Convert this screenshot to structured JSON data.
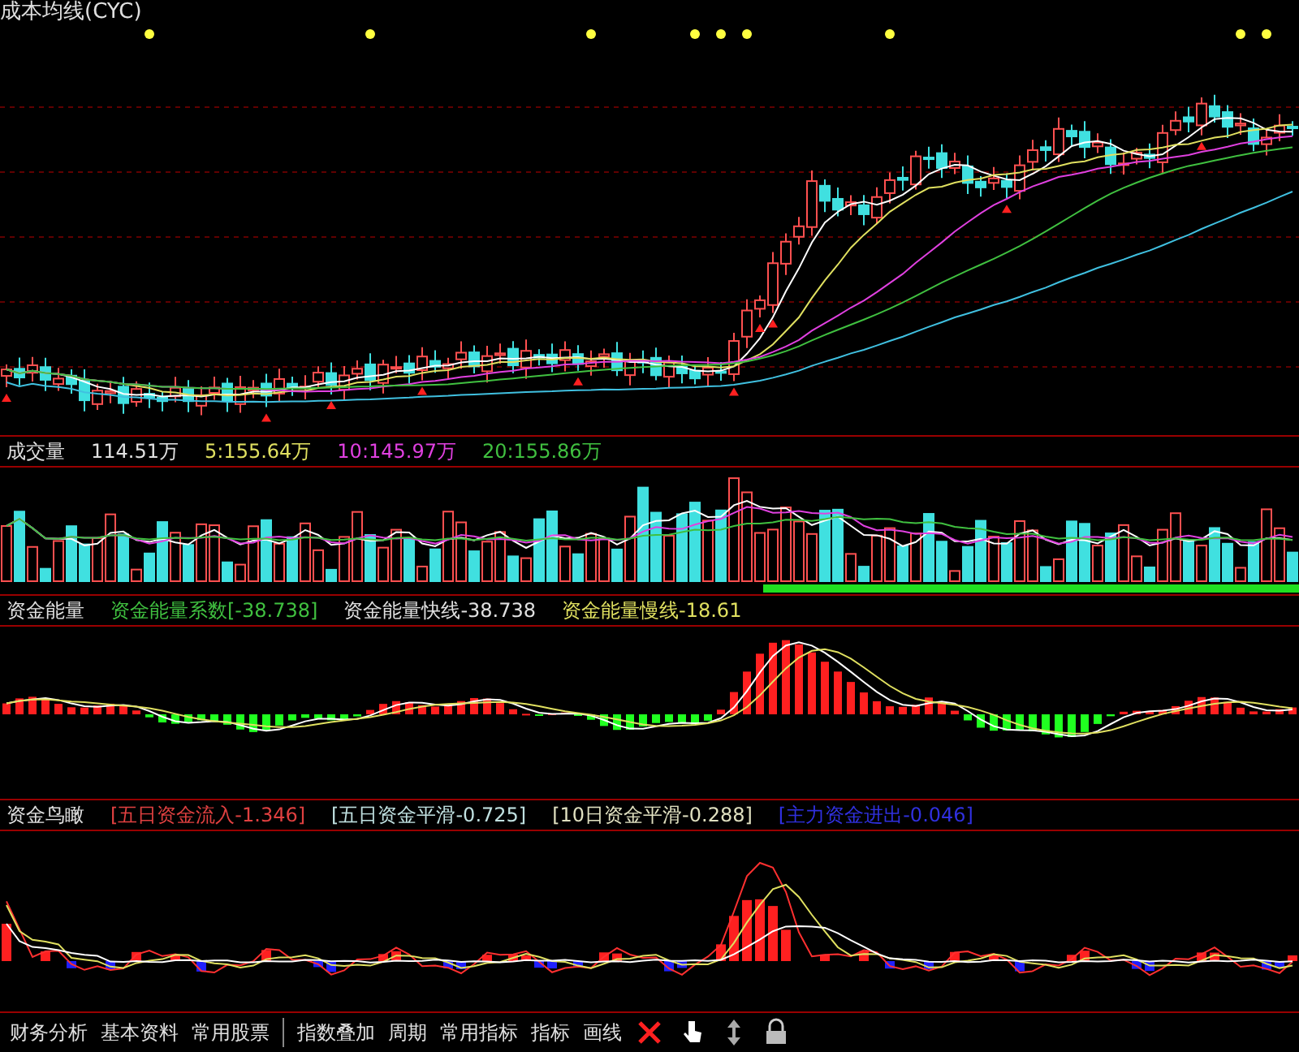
{
  "main_panel": {
    "title": "成本均线(CYC)"
  },
  "volume_panel": {
    "legend": [
      {
        "text": "成交量",
        "color": "#e0e0e0"
      },
      {
        "text": "114.51万",
        "color": "#e0e0e0"
      },
      {
        "text": "5:155.64万",
        "color": "#e0e060"
      },
      {
        "text": "10:145.97万",
        "color": "#e040e0"
      },
      {
        "text": "20:155.86万",
        "color": "#40c040"
      }
    ]
  },
  "energy_panel": {
    "legend": [
      {
        "text": "资金能量",
        "color": "#e0e0e0"
      },
      {
        "text": "资金能量系数[-38.738]",
        "color": "#40c040"
      },
      {
        "text": "资金能量快线-38.738",
        "color": "#e0e0e0"
      },
      {
        "text": "资金能量慢线-18.61",
        "color": "#e0e060"
      }
    ]
  },
  "flow_panel": {
    "legend": [
      {
        "text": "资金鸟瞰",
        "color": "#e0e0e0"
      },
      {
        "text": "[五日资金流入-1.346]",
        "color": "#e04040"
      },
      {
        "text": "[五日资金平滑-0.725]",
        "color": "#c0e0e0"
      },
      {
        "text": "[10日资金平滑-0.288]",
        "color": "#e0e0c0"
      },
      {
        "text": "[主力资金进出-0.046]",
        "color": "#3030e0"
      }
    ]
  },
  "toolbar": {
    "left_items": [
      "财务分析",
      "基本资料",
      "常用股票"
    ],
    "right_items": [
      "指数叠加",
      "周期",
      "常用指标",
      "指标",
      "画线"
    ]
  }
}
